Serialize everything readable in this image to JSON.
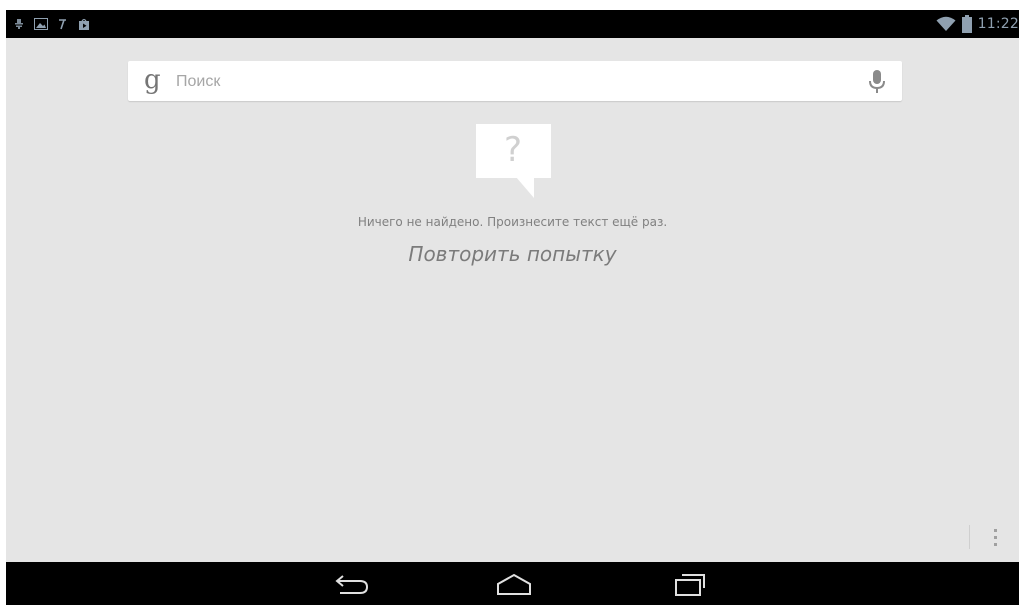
{
  "status_bar": {
    "time": "11:22",
    "left_icons": [
      "usb-debug-icon",
      "image-notification-icon",
      "text-notification-icon",
      "play-store-notification-icon"
    ],
    "right_icons": [
      "wifi-icon",
      "battery-icon"
    ],
    "icon_color": "#8fa0b0"
  },
  "search": {
    "logo": "g",
    "placeholder": "Поиск",
    "value": ""
  },
  "message": {
    "no_results": "Ничего не найдено. Произнесите текст ещё раз.",
    "retry": "Повторить попытку"
  },
  "nav_bar": {
    "buttons": [
      "back-button",
      "home-button",
      "recent-apps-button"
    ]
  },
  "colors": {
    "background": "#e5e5e5",
    "bars": "#000000",
    "muted_text": "#808080"
  }
}
